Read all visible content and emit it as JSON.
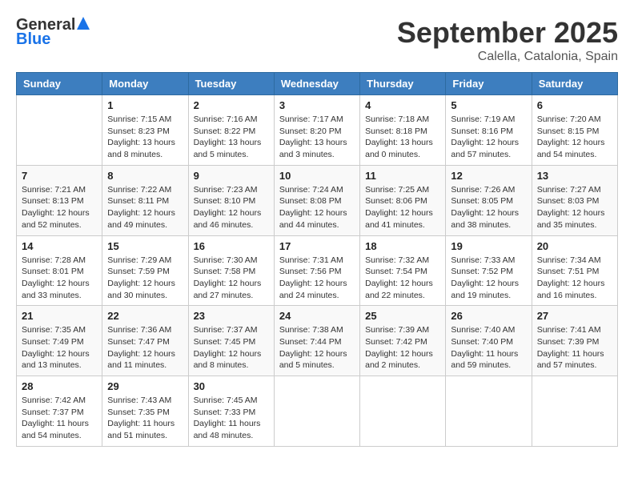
{
  "header": {
    "logo_line1": "General",
    "logo_line2": "Blue",
    "month": "September 2025",
    "location": "Calella, Catalonia, Spain"
  },
  "days_of_week": [
    "Sunday",
    "Monday",
    "Tuesday",
    "Wednesday",
    "Thursday",
    "Friday",
    "Saturday"
  ],
  "weeks": [
    [
      {
        "day": "",
        "info": ""
      },
      {
        "day": "1",
        "info": "Sunrise: 7:15 AM\nSunset: 8:23 PM\nDaylight: 13 hours\nand 8 minutes."
      },
      {
        "day": "2",
        "info": "Sunrise: 7:16 AM\nSunset: 8:22 PM\nDaylight: 13 hours\nand 5 minutes."
      },
      {
        "day": "3",
        "info": "Sunrise: 7:17 AM\nSunset: 8:20 PM\nDaylight: 13 hours\nand 3 minutes."
      },
      {
        "day": "4",
        "info": "Sunrise: 7:18 AM\nSunset: 8:18 PM\nDaylight: 13 hours\nand 0 minutes."
      },
      {
        "day": "5",
        "info": "Sunrise: 7:19 AM\nSunset: 8:16 PM\nDaylight: 12 hours\nand 57 minutes."
      },
      {
        "day": "6",
        "info": "Sunrise: 7:20 AM\nSunset: 8:15 PM\nDaylight: 12 hours\nand 54 minutes."
      }
    ],
    [
      {
        "day": "7",
        "info": "Sunrise: 7:21 AM\nSunset: 8:13 PM\nDaylight: 12 hours\nand 52 minutes."
      },
      {
        "day": "8",
        "info": "Sunrise: 7:22 AM\nSunset: 8:11 PM\nDaylight: 12 hours\nand 49 minutes."
      },
      {
        "day": "9",
        "info": "Sunrise: 7:23 AM\nSunset: 8:10 PM\nDaylight: 12 hours\nand 46 minutes."
      },
      {
        "day": "10",
        "info": "Sunrise: 7:24 AM\nSunset: 8:08 PM\nDaylight: 12 hours\nand 44 minutes."
      },
      {
        "day": "11",
        "info": "Sunrise: 7:25 AM\nSunset: 8:06 PM\nDaylight: 12 hours\nand 41 minutes."
      },
      {
        "day": "12",
        "info": "Sunrise: 7:26 AM\nSunset: 8:05 PM\nDaylight: 12 hours\nand 38 minutes."
      },
      {
        "day": "13",
        "info": "Sunrise: 7:27 AM\nSunset: 8:03 PM\nDaylight: 12 hours\nand 35 minutes."
      }
    ],
    [
      {
        "day": "14",
        "info": "Sunrise: 7:28 AM\nSunset: 8:01 PM\nDaylight: 12 hours\nand 33 minutes."
      },
      {
        "day": "15",
        "info": "Sunrise: 7:29 AM\nSunset: 7:59 PM\nDaylight: 12 hours\nand 30 minutes."
      },
      {
        "day": "16",
        "info": "Sunrise: 7:30 AM\nSunset: 7:58 PM\nDaylight: 12 hours\nand 27 minutes."
      },
      {
        "day": "17",
        "info": "Sunrise: 7:31 AM\nSunset: 7:56 PM\nDaylight: 12 hours\nand 24 minutes."
      },
      {
        "day": "18",
        "info": "Sunrise: 7:32 AM\nSunset: 7:54 PM\nDaylight: 12 hours\nand 22 minutes."
      },
      {
        "day": "19",
        "info": "Sunrise: 7:33 AM\nSunset: 7:52 PM\nDaylight: 12 hours\nand 19 minutes."
      },
      {
        "day": "20",
        "info": "Sunrise: 7:34 AM\nSunset: 7:51 PM\nDaylight: 12 hours\nand 16 minutes."
      }
    ],
    [
      {
        "day": "21",
        "info": "Sunrise: 7:35 AM\nSunset: 7:49 PM\nDaylight: 12 hours\nand 13 minutes."
      },
      {
        "day": "22",
        "info": "Sunrise: 7:36 AM\nSunset: 7:47 PM\nDaylight: 12 hours\nand 11 minutes."
      },
      {
        "day": "23",
        "info": "Sunrise: 7:37 AM\nSunset: 7:45 PM\nDaylight: 12 hours\nand 8 minutes."
      },
      {
        "day": "24",
        "info": "Sunrise: 7:38 AM\nSunset: 7:44 PM\nDaylight: 12 hours\nand 5 minutes."
      },
      {
        "day": "25",
        "info": "Sunrise: 7:39 AM\nSunset: 7:42 PM\nDaylight: 12 hours\nand 2 minutes."
      },
      {
        "day": "26",
        "info": "Sunrise: 7:40 AM\nSunset: 7:40 PM\nDaylight: 11 hours\nand 59 minutes."
      },
      {
        "day": "27",
        "info": "Sunrise: 7:41 AM\nSunset: 7:39 PM\nDaylight: 11 hours\nand 57 minutes."
      }
    ],
    [
      {
        "day": "28",
        "info": "Sunrise: 7:42 AM\nSunset: 7:37 PM\nDaylight: 11 hours\nand 54 minutes."
      },
      {
        "day": "29",
        "info": "Sunrise: 7:43 AM\nSunset: 7:35 PM\nDaylight: 11 hours\nand 51 minutes."
      },
      {
        "day": "30",
        "info": "Sunrise: 7:45 AM\nSunset: 7:33 PM\nDaylight: 11 hours\nand 48 minutes."
      },
      {
        "day": "",
        "info": ""
      },
      {
        "day": "",
        "info": ""
      },
      {
        "day": "",
        "info": ""
      },
      {
        "day": "",
        "info": ""
      }
    ]
  ]
}
